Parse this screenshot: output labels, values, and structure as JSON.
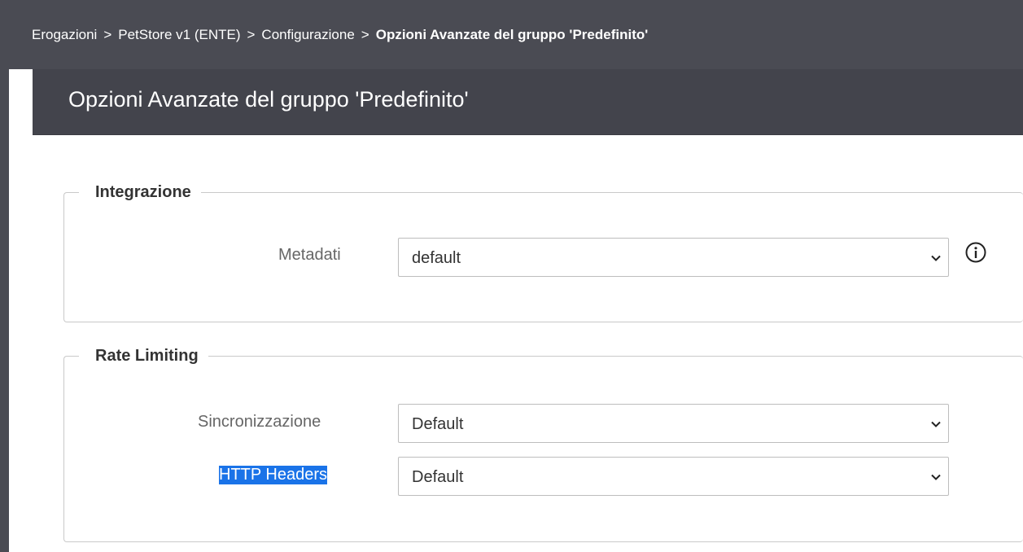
{
  "breadcrumb": {
    "items": [
      "Erogazioni",
      "PetStore v1 (ENTE)",
      "Configurazione"
    ],
    "current": "Opzioni Avanzate del gruppo 'Predefinito'",
    "separator": ">"
  },
  "page": {
    "title": "Opzioni Avanzate del gruppo 'Predefinito'"
  },
  "sections": {
    "integrazione": {
      "legend": "Integrazione",
      "metadati": {
        "label": "Metadati",
        "value": "default",
        "info_icon": "info-circle-icon"
      }
    },
    "rate_limiting": {
      "legend": "Rate Limiting",
      "sincronizzazione": {
        "label": "Sincronizzazione",
        "value": "Default"
      },
      "http_headers": {
        "label": "HTTP Headers",
        "value": "Default",
        "highlighted": true
      }
    }
  },
  "colors": {
    "header_bg": "#43444c",
    "breadcrumb_bg": "#4a4b53",
    "selection_highlight": "#1a73e8"
  }
}
